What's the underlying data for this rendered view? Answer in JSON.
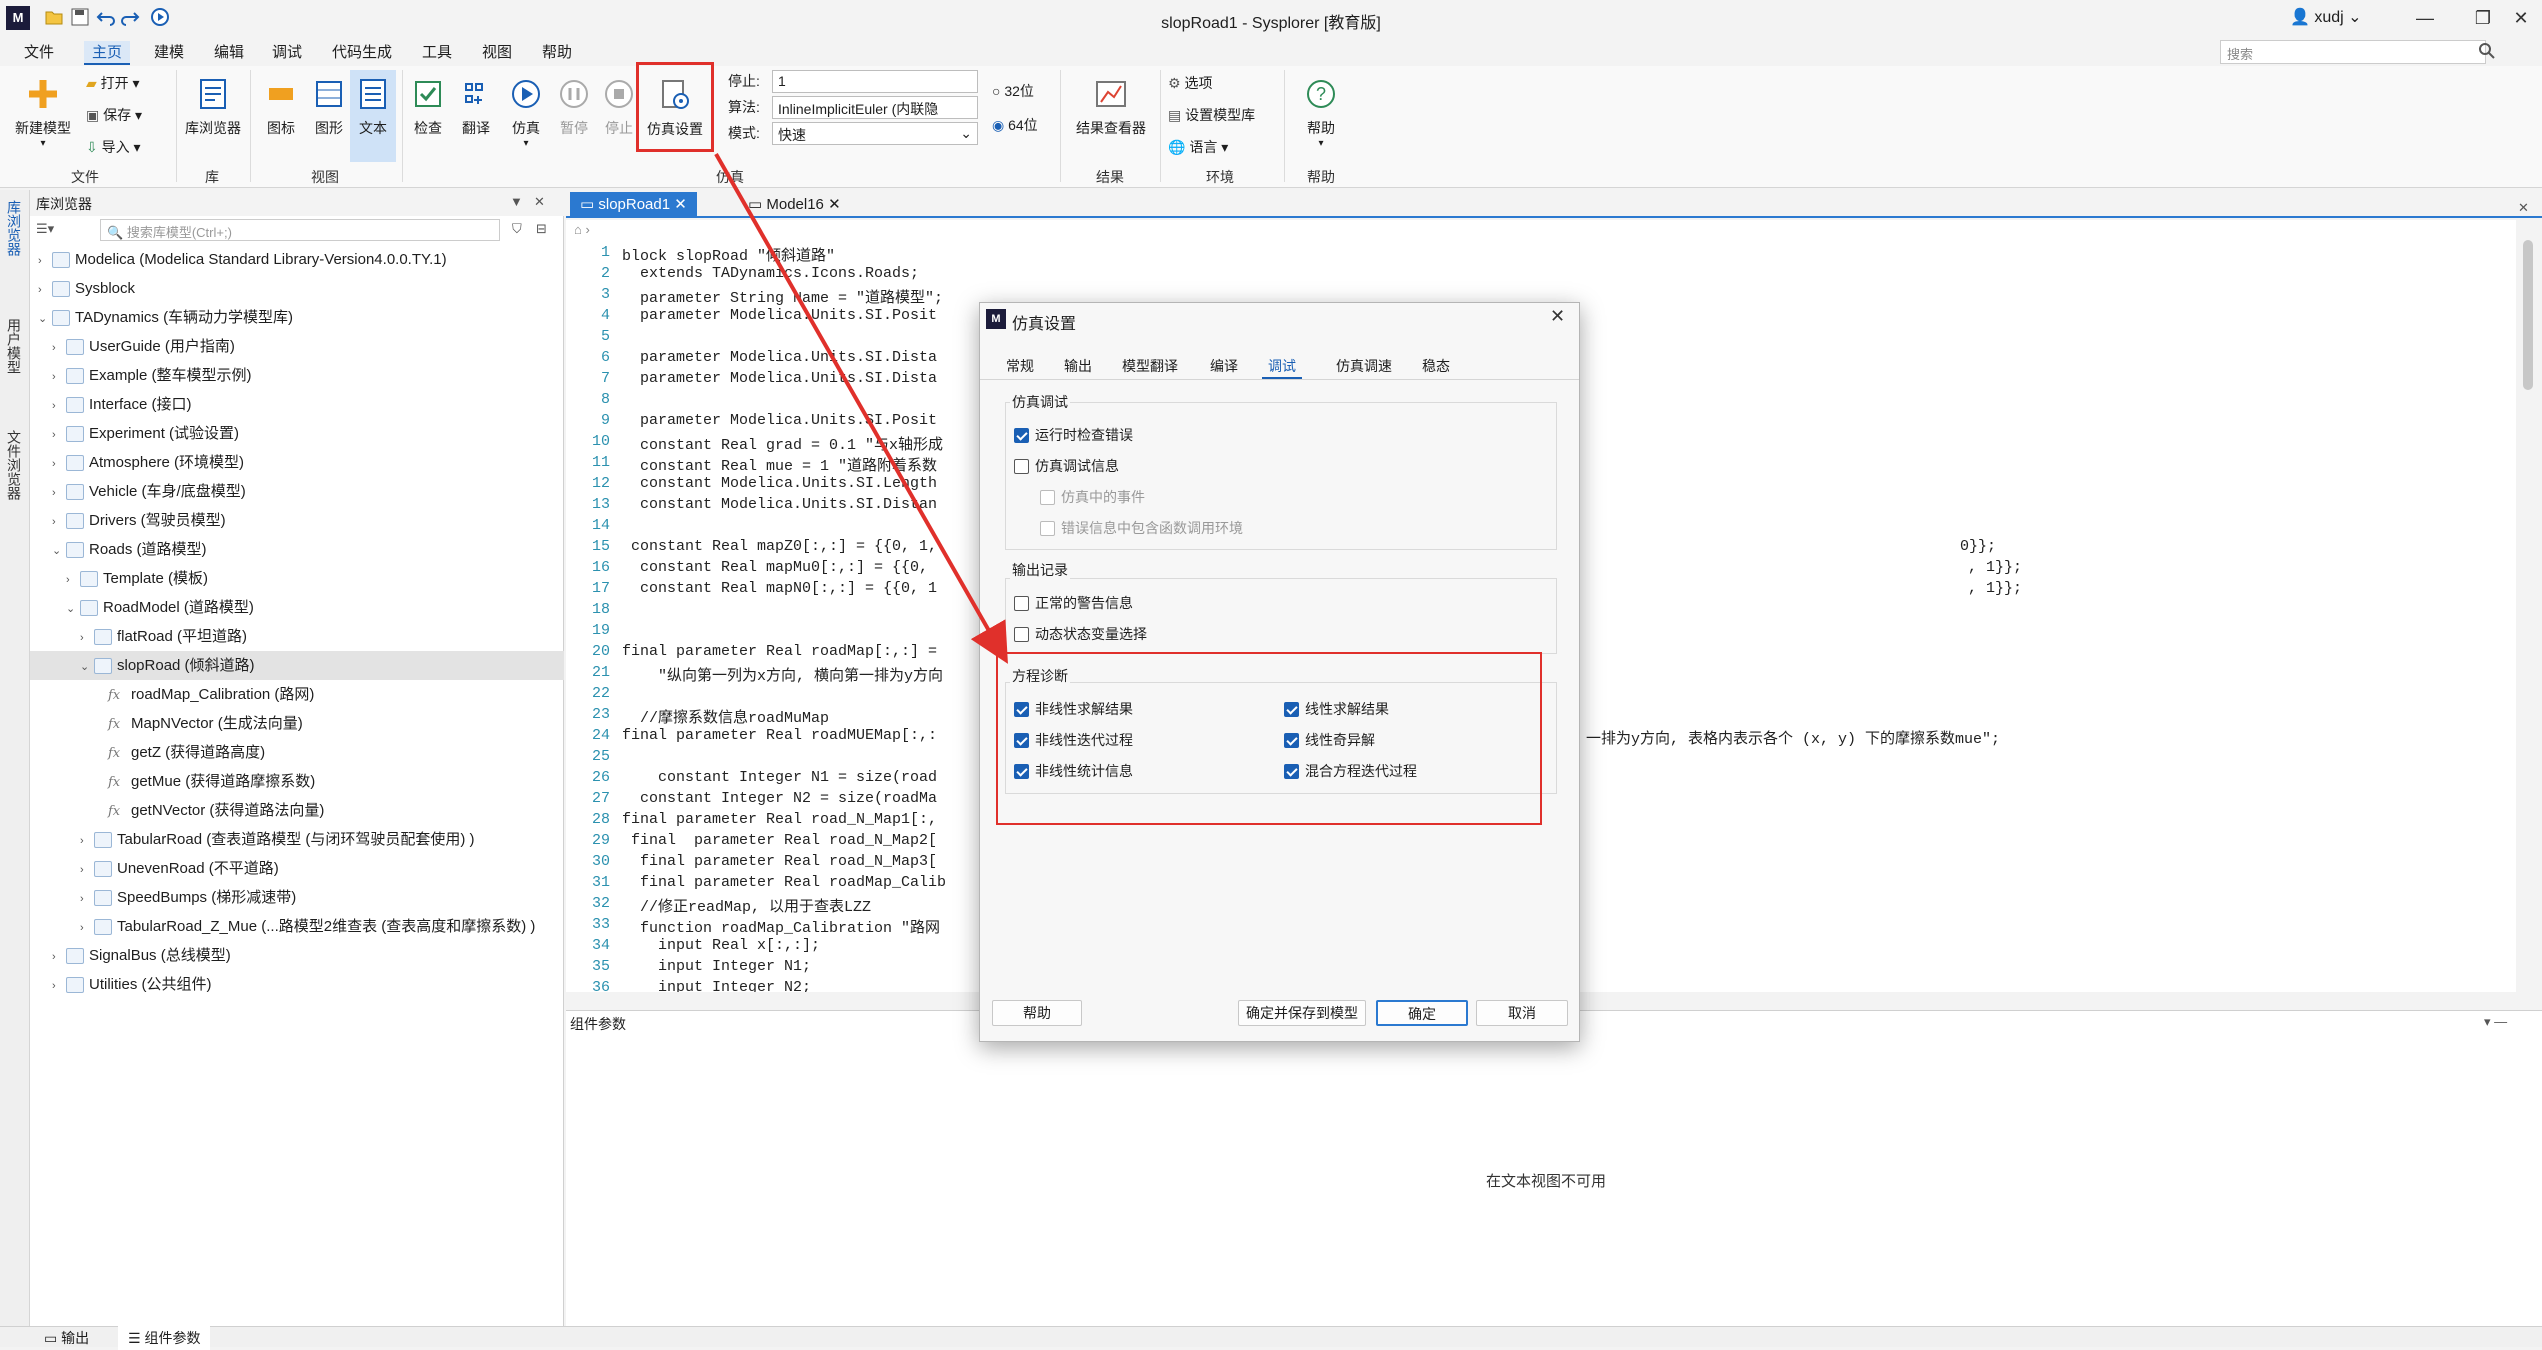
{
  "window": {
    "title": "slopRoad1 - Sysplorer [教育版]",
    "user": "xudj",
    "logo": "M"
  },
  "menu": [
    "文件",
    "主页",
    "建模",
    "编辑",
    "调试",
    "代码生成",
    "工具",
    "视图",
    "帮助"
  ],
  "search_placeholder": "搜索",
  "ribbon": {
    "new_model": "新建模型",
    "open": "打开",
    "save": "保存",
    "import": "导入",
    "lib_browser": "库浏览器",
    "icon_view": "图标",
    "diagram_view": "图形",
    "text_view": "文本",
    "check": "检查",
    "translate": "翻译",
    "simulate": "仿真",
    "pause": "暂停",
    "stop": "停止",
    "sim_settings": "仿真设置",
    "stop_time_label": "停止:",
    "stop_time_value": "1",
    "algo_label": "算法:",
    "algo_value": "InlineImplicitEuler (内联隐",
    "mode_label": "模式:",
    "mode_value": "快速",
    "bit32": "32位",
    "bit64": "64位",
    "result_viewer": "结果查看器",
    "options": "选项",
    "set_model_lib": "设置模型库",
    "language": "语言",
    "help": "帮助",
    "groups": {
      "file": "文件",
      "lib": "库",
      "view": "视图",
      "sim": "仿真",
      "result": "结果",
      "env": "环境",
      "help": "帮助"
    }
  },
  "side_tabs": [
    "库浏览器",
    "用户模型",
    "文件浏览器"
  ],
  "library": {
    "title": "库浏览器",
    "search_placeholder": "搜索库模型(Ctrl+;)",
    "items": [
      {
        "label": "Modelica (Modelica Standard Library-Version4.0.0.TY.1)",
        "arrow": "›"
      },
      {
        "label": "Sysblock",
        "arrow": "›"
      },
      {
        "label": "TADynamics (车辆动力学模型库)",
        "arrow": "⌄"
      },
      {
        "label": "UserGuide (用户指南)",
        "arrow": "›"
      },
      {
        "label": "Example (整车模型示例)",
        "arrow": "›"
      },
      {
        "label": "Interface (接口)",
        "arrow": "›"
      },
      {
        "label": "Experiment (试验设置)",
        "arrow": "›"
      },
      {
        "label": "Atmosphere (环境模型)",
        "arrow": "›"
      },
      {
        "label": "Vehicle (车身/底盘模型)",
        "arrow": "›"
      },
      {
        "label": "Drivers (驾驶员模型)",
        "arrow": "›"
      },
      {
        "label": "Roads (道路模型)",
        "arrow": "⌄"
      },
      {
        "label": "Template (模板)",
        "arrow": "›"
      },
      {
        "label": "RoadModel (道路模型)",
        "arrow": "⌄"
      },
      {
        "label": "flatRoad (平坦道路)",
        "arrow": "›"
      },
      {
        "label": "slopRoad (倾斜道路)",
        "arrow": "⌄"
      },
      {
        "label": "roadMap_Calibration (路网)",
        "arrow": "fx"
      },
      {
        "label": "MapNVector (生成法向量)",
        "arrow": "fx"
      },
      {
        "label": "getZ (获得道路高度)",
        "arrow": "fx"
      },
      {
        "label": "getMue (获得道路摩擦系数)",
        "arrow": "fx"
      },
      {
        "label": "getNVector (获得道路法向量)",
        "arrow": "fx"
      },
      {
        "label": "TabularRoad (查表道路模型 (与闭环驾驶员配套使用) )",
        "arrow": "›"
      },
      {
        "label": "UnevenRoad (不平道路)",
        "arrow": "›"
      },
      {
        "label": "SpeedBumps (梯形减速带)",
        "arrow": "›"
      },
      {
        "label": "TabularRoad_Z_Mue (...路模型2维查表 (查表高度和摩擦系数) )",
        "arrow": "›"
      },
      {
        "label": "SignalBus (总线模型)",
        "arrow": "›"
      },
      {
        "label": "Utilities (公共组件)",
        "arrow": "›"
      }
    ]
  },
  "editor_tabs": [
    "slopRoad1",
    "Model16"
  ],
  "code_lines": [
    {
      "n": "1",
      "t": "block slopRoad \"倾斜道路\""
    },
    {
      "n": "2",
      "t": "  extends TADynamics.Icons.Roads;"
    },
    {
      "n": "3",
      "t": "  parameter String Name = \"道路模型\";"
    },
    {
      "n": "4",
      "t": "  parameter Modelica.Units.SI.Posit"
    },
    {
      "n": "5",
      "t": ""
    },
    {
      "n": "6",
      "t": "  parameter Modelica.Units.SI.Dista"
    },
    {
      "n": "7",
      "t": "  parameter Modelica.Units.SI.Dista"
    },
    {
      "n": "8",
      "t": ""
    },
    {
      "n": "9",
      "t": "  parameter Modelica.Units.SI.Posit"
    },
    {
      "n": "10",
      "t": "  constant Real grad = 0.1 \"与x轴形成"
    },
    {
      "n": "11",
      "t": "  constant Real mue = 1 \"道路附着系数"
    },
    {
      "n": "12",
      "t": "  constant Modelica.Units.SI.Length"
    },
    {
      "n": "13",
      "t": "  constant Modelica.Units.SI.Distan"
    },
    {
      "n": "14",
      "t": ""
    },
    {
      "n": "15",
      "t": " constant Real mapZ0[:,:] = {{0, 1,",
      "tail": "0}};"
    },
    {
      "n": "16",
      "t": "  constant Real mapMu0[:,:] = {{0,",
      "tail": ", 1}};"
    },
    {
      "n": "17",
      "t": "  constant Real mapN0[:,:] = {{0, 1",
      "tail": ", 1}};"
    },
    {
      "n": "18",
      "t": ""
    },
    {
      "n": "19",
      "t": ""
    },
    {
      "n": "20",
      "t": "final parameter Real roadMap[:,:] ="
    },
    {
      "n": "21",
      "t": "    \"纵向第一列为x方向, 横向第一排为y方向"
    },
    {
      "n": "22",
      "t": ""
    },
    {
      "n": "23",
      "t": "  //摩擦系数信息roadMuMap"
    },
    {
      "n": "24",
      "t": "final parameter Real roadMUEMap[:,:",
      "tail": "一排为y方向, 表格内表示各个 (x, y) 下的摩擦系数mue\";"
    },
    {
      "n": "25",
      "t": ""
    },
    {
      "n": "26",
      "t": "    constant Integer N1 = size(road"
    },
    {
      "n": "27",
      "t": "  constant Integer N2 = size(roadMa"
    },
    {
      "n": "28",
      "t": "final parameter Real road_N_Map1[:,"
    },
    {
      "n": "29",
      "t": " final  parameter Real road_N_Map2["
    },
    {
      "n": "30",
      "t": "  final parameter Real road_N_Map3["
    },
    {
      "n": "31",
      "t": "  final parameter Real roadMap_Calib"
    },
    {
      "n": "32",
      "t": "  //修正readMap, 以用于查表LZZ"
    },
    {
      "n": "33",
      "t": "  function roadMap_Calibration \"路网"
    },
    {
      "n": "34",
      "t": "    input Real x[:,:];"
    },
    {
      "n": "35",
      "t": "    input Integer N1;"
    },
    {
      "n": "36",
      "t": "    input Integer N2;"
    }
  ],
  "params_panel": {
    "title": "组件参数",
    "empty_text": "在文本视图不可用"
  },
  "status_tabs": [
    "输出",
    "组件参数"
  ],
  "dialog": {
    "title": "仿真设置",
    "tabs": [
      "常规",
      "输出",
      "模型翻译",
      "编译",
      "调试",
      "仿真调速",
      "稳态"
    ],
    "active_tab": "调试",
    "group_debug": {
      "title": "仿真调试",
      "items": [
        {
          "label": "运行时检查错误",
          "checked": true,
          "disabled": false
        },
        {
          "label": "仿真调试信息",
          "checked": false,
          "disabled": false
        },
        {
          "label": "仿真中的事件",
          "checked": false,
          "disabled": true
        },
        {
          "label": "错误信息中包含函数调用环境",
          "checked": false,
          "disabled": true
        }
      ]
    },
    "group_output": {
      "title": "输出记录",
      "items": [
        {
          "label": "正常的警告信息",
          "checked": false
        },
        {
          "label": "动态状态变量选择",
          "checked": false
        }
      ]
    },
    "group_diag": {
      "title": "方程诊断",
      "items": [
        {
          "label": "非线性求解结果",
          "checked": true
        },
        {
          "label": "线性求解结果",
          "checked": true
        },
        {
          "label": "非线性迭代过程",
          "checked": true
        },
        {
          "label": "线性奇异解",
          "checked": true
        },
        {
          "label": "非线性统计信息",
          "checked": true
        },
        {
          "label": "混合方程迭代过程",
          "checked": true
        }
      ]
    },
    "buttons": {
      "help": "帮助",
      "save_to_model": "确定并保存到模型",
      "ok": "确定",
      "cancel": "取消"
    }
  },
  "annotation_color": "#e0302b"
}
